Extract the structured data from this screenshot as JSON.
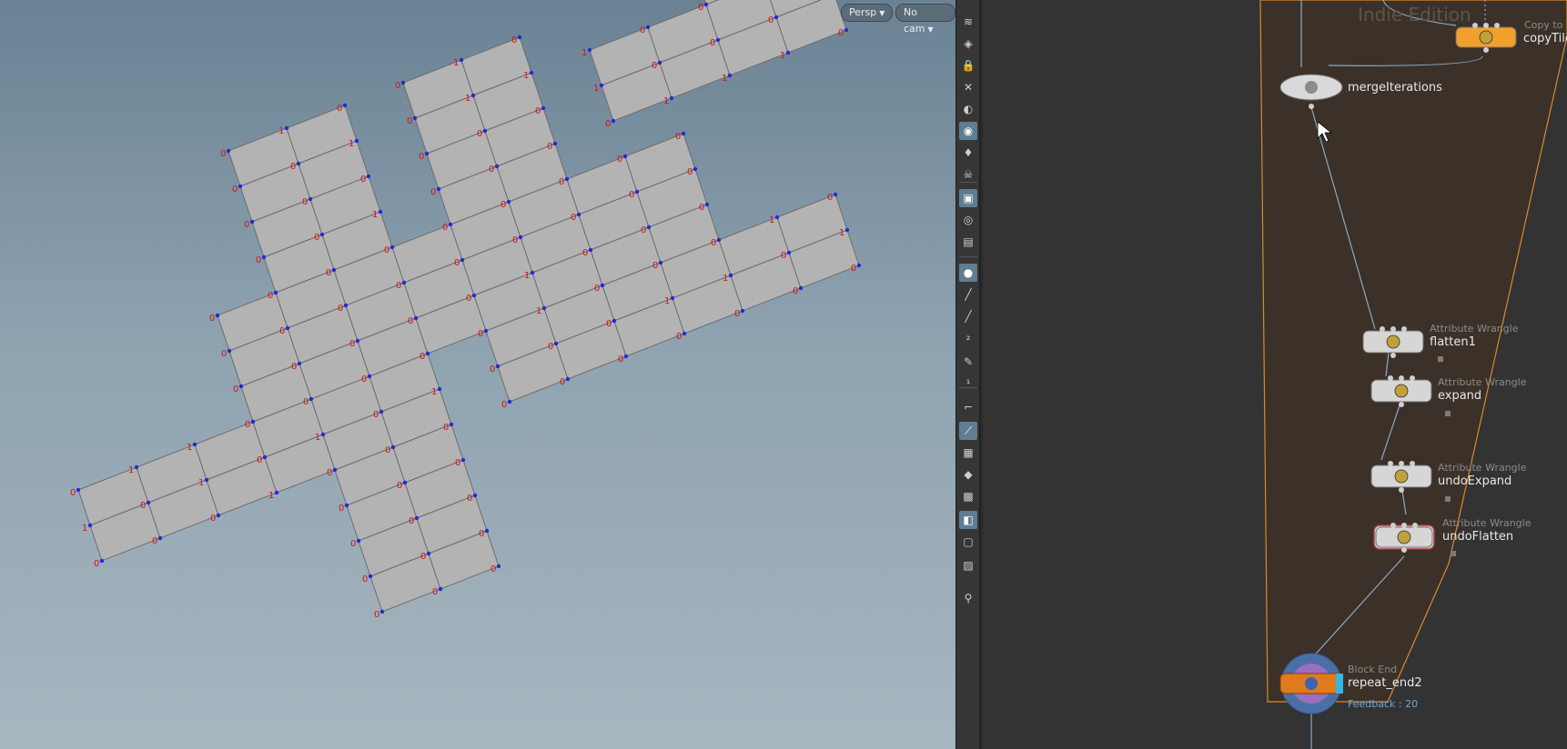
{
  "viewport": {
    "projection_button": "Persp",
    "camera_button": "No cam",
    "point_labels": [
      "0",
      "1",
      "0",
      "1",
      "0",
      "0",
      "1",
      "1",
      "0",
      "0",
      "0",
      "1",
      "0",
      "1",
      "0",
      "0",
      "0",
      "0",
      "0",
      "1",
      "0",
      "0",
      "0",
      "0",
      "0",
      "0",
      "0",
      "0",
      "0",
      "0",
      "0",
      "0",
      "0",
      "0",
      "0",
      "0",
      "0",
      "0",
      "0",
      "0",
      "0",
      "1",
      "0",
      "1",
      "0",
      "0",
      "0",
      "0",
      "1",
      "0",
      "0",
      "0",
      "0",
      "0",
      "0",
      "0",
      "0",
      "0",
      "0",
      "0",
      "0",
      "0",
      "0",
      "1",
      "1",
      "0",
      "0",
      "0",
      "0",
      "0",
      "0",
      "0",
      "0",
      "0",
      "0",
      "0",
      "0",
      "0",
      "1",
      "1",
      "0",
      "0",
      "0",
      "0",
      "0",
      "0",
      "1",
      "0",
      "0",
      "0",
      "0",
      "0",
      "0",
      "0",
      "0",
      "1",
      "0",
      "1",
      "0",
      "1",
      "0",
      "0"
    ]
  },
  "toolbar": {
    "icons": [
      "display-options-icon",
      "ghost-icon",
      "lock-icon",
      "snap-icon",
      "shading-icon",
      "light-icon",
      "lightbulb-icon",
      "skull-icon",
      "camera-icon",
      "eye-icon",
      "render-icon",
      "point-display-icon",
      "brush-icon",
      "dropper-icon",
      "point-number-icon",
      "paint-icon",
      "primitive-number-icon",
      "corner-icon",
      "normal-icon",
      "texture-icon",
      "uv-icon",
      "geo-icon",
      "wire-icon",
      "frame-icon",
      "background-icon",
      "pin-icon"
    ]
  },
  "network": {
    "watermark": "Indie Edition",
    "nodes": [
      {
        "name": "copyTile",
        "type": "Copy to P"
      },
      {
        "name": "mergeIterations",
        "type": ""
      },
      {
        "name": "flatten1",
        "type": "Attribute Wrangle"
      },
      {
        "name": "expand",
        "type": "Attribute Wrangle"
      },
      {
        "name": "undoExpand",
        "type": "Attribute Wrangle"
      },
      {
        "name": "undoFlatten",
        "type": "Attribute Wrangle"
      },
      {
        "name": "repeat_end2",
        "type": "Block End",
        "feedback": "Feedback : 20"
      }
    ],
    "colors": {
      "block_outline": "#d98a2a",
      "block_fill": "#3b3128",
      "wire": "#8aa9c8",
      "selected_node": "#f2a02c"
    }
  }
}
